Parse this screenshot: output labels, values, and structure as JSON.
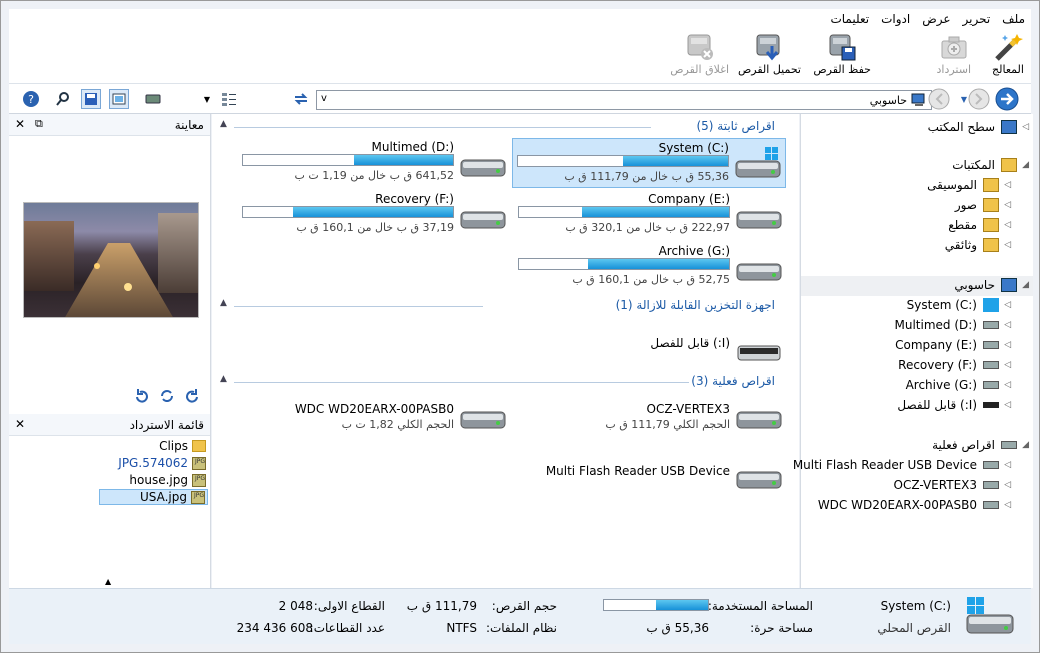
{
  "menu": [
    "ملف",
    "تحرير",
    "عرض",
    "ادوات",
    "تعليمات"
  ],
  "toolbar": {
    "wizard": "المعالج",
    "restore": "استرداد",
    "save_disk": "حفظ القرص",
    "load_disk": "تحميل القرص",
    "close_disk": "اغلاق القرص"
  },
  "address": {
    "value": "حاسوبي"
  },
  "left": {
    "preview_title": "معاينة",
    "restore_list_title": "قائمة الاسترداد",
    "files": [
      {
        "name": "Clips",
        "type": "folder"
      },
      {
        "name": "574062.JPG",
        "type": "jpg"
      },
      {
        "name": "house.jpg",
        "type": "jpg"
      },
      {
        "name": "USA.jpg",
        "type": "jpg"
      }
    ]
  },
  "groups": {
    "fixed": "اقراص ثابتة (5)",
    "removable": "اجهزة التخزين القابلة للازالة (1)",
    "physical": "اقراص فعلية (3)"
  },
  "drives": [
    {
      "name": "System (C:)",
      "sub": "55,36 ق ب خال من 111,79 ق ب",
      "fill": 0.5,
      "win": true
    },
    {
      "name": "Multimed (D:)",
      "sub": "641,52 ق ب خال من 1,19 ت ب",
      "fill": 0.47
    },
    {
      "name": "Company (E:)",
      "sub": "222,97 ق ب خال من 320,1 ق ب",
      "fill": 0.7
    },
    {
      "name": "Recovery (F:)",
      "sub": "37,19 ق ب خال من 160,1 ق ب",
      "fill": 0.76
    },
    {
      "name": "Archive (G:)",
      "sub": "52,75 ق ب خال من 160,1 ق ب",
      "fill": 0.67
    }
  ],
  "removable": [
    {
      "name": "(I:) قابل للفصل"
    }
  ],
  "physical": [
    {
      "name": "OCZ-VERTEX3",
      "sub": "الحجم الكلي 111,79 ق ب"
    },
    {
      "name": "WDC WD20EARX-00PASB0",
      "sub": "الحجم الكلي 1,82 ت ب"
    },
    {
      "name": "Multi Flash Reader USB Device",
      "sub": ""
    }
  ],
  "tree": {
    "desktop": "سطح المكتب",
    "libraries": "المكتبات",
    "music": "الموسيقى",
    "pictures": "صور",
    "video": "مقطع",
    "documents": "وثائقي",
    "computer": "حاسوبي",
    "physical": "اقراص فعلية",
    "drives": [
      "System (C:)",
      "Multimed (D:)",
      "Company (E:)",
      "Recovery (F:)",
      "Archive (G:)",
      "(I:) قابل للفصل"
    ],
    "disks": [
      "Multi Flash Reader USB Device",
      "OCZ-VERTEX3",
      "WDC WD20EARX-00PASB0"
    ]
  },
  "status": {
    "name": "System (C:)",
    "type": "القرص المحلي",
    "used_label": "المساحة المستخدمة:",
    "used_fill": 0.5,
    "free_label": "مساحة حرة:",
    "free_value": "55,36 ق ب",
    "size_label": "حجم القرص:",
    "size_value": "111,79 ق ب",
    "fs_label": "نظام الملفات:",
    "fs_value": "NTFS",
    "first_label": "القطاع الاولى:",
    "first_value": "2 048",
    "count_label": "عدد القطاعات:",
    "count_value": "234 436 608"
  }
}
